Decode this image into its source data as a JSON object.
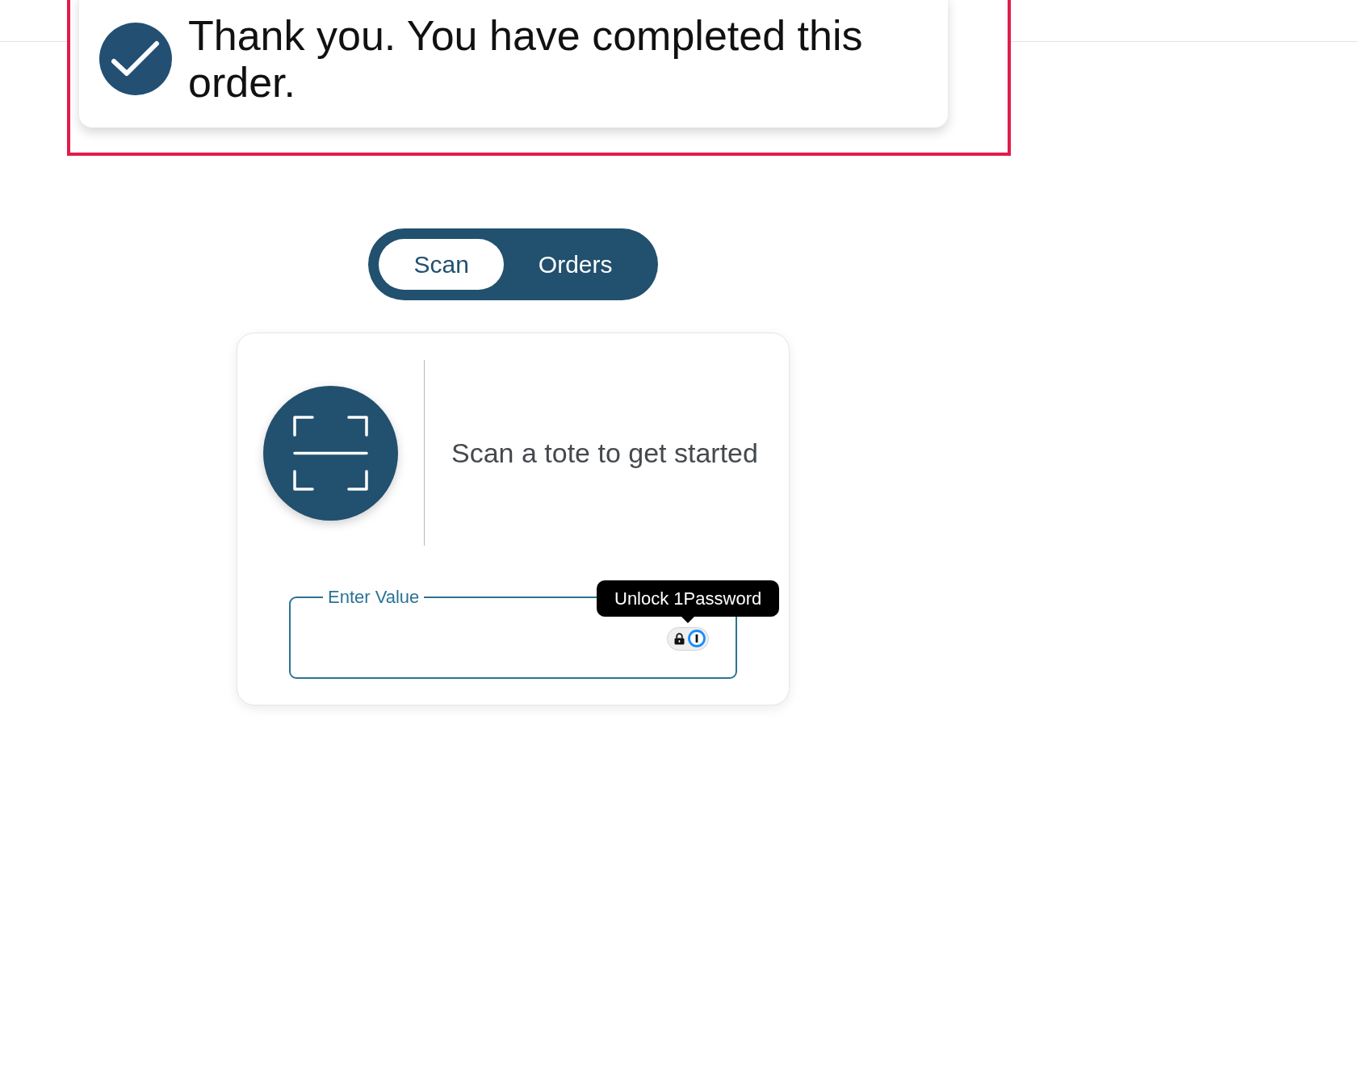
{
  "toast": {
    "message": "Thank you. You have completed this order.",
    "highlighted": true
  },
  "tabs": [
    {
      "label": "Scan",
      "selected": true
    },
    {
      "label": "Orders",
      "selected": false
    }
  ],
  "scan_card": {
    "prompt": "Scan a tote to get started",
    "field": {
      "label": "Enter Value"
    }
  },
  "autofill": {
    "tooltip": "Unlock 1Password"
  }
}
